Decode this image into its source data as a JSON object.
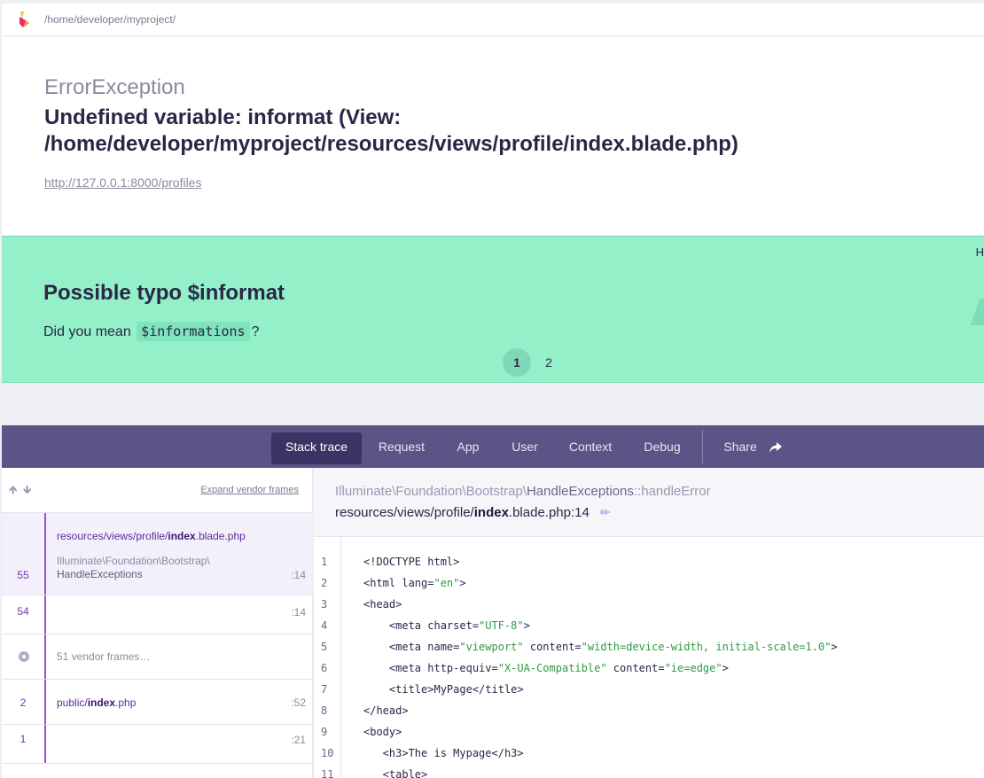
{
  "topbar": {
    "path": "/home/developer/myproject/"
  },
  "exception": {
    "class": "ErrorException",
    "message": "Undefined variable: informat (View: /home/developer/myproject/resources/views/profile/index.blade.php)",
    "url": "http://127.0.0.1:8000/profiles"
  },
  "solution": {
    "title": "Possible typo $informat",
    "text_before": "Did you mean",
    "code": "$informations",
    "text_after": "?",
    "tabs": [
      "1",
      "2"
    ],
    "edge_text": "H"
  },
  "tabs": [
    "Stack trace",
    "Request",
    "App",
    "User",
    "Context",
    "Debug"
  ],
  "share_label": "Share",
  "stack": {
    "expand_label": "Expand vendor frames",
    "frames": [
      {
        "num": "55",
        "file_prefix": "resources/views/profile/",
        "file_bold": "index",
        "file_suffix": ".blade.php",
        "cls1": "Illuminate\\Foundation\\Bootstrap\\",
        "cls2": "HandleExceptions",
        "line": ":14"
      },
      {
        "num": "54",
        "line": ":14"
      },
      {
        "vendor_label": "51 vendor frames…"
      },
      {
        "num": "2",
        "file_prefix": "public/",
        "file_bold": "index",
        "file_suffix": ".php",
        "line": ":52"
      },
      {
        "num": "1",
        "line": ":21"
      }
    ]
  },
  "code_view": {
    "namespace": "Illuminate\\Foundation\\Bootstrap\\",
    "class": "HandleExceptions",
    "method": "::handleError",
    "file_prefix": "resources/views/profile/",
    "file_bold": "index",
    "file_suffix": ".blade.php:14",
    "lines": [
      {
        "n": "1",
        "code": "<!DOCTYPE html>"
      },
      {
        "n": "2",
        "code": "<html lang=\"en\">"
      },
      {
        "n": "3",
        "code": "<head>"
      },
      {
        "n": "4",
        "code": "    <meta charset=\"UTF-8\">"
      },
      {
        "n": "5",
        "code": "    <meta name=\"viewport\" content=\"width=device-width, initial-scale=1.0\">"
      },
      {
        "n": "6",
        "code": "    <meta http-equiv=\"X-UA-Compatible\" content=\"ie=edge\">"
      },
      {
        "n": "7",
        "code": "    <title>MyPage</title>"
      },
      {
        "n": "8",
        "code": "</head>"
      },
      {
        "n": "9",
        "code": "<body>"
      },
      {
        "n": "10",
        "code": "   <h3>The is Mypage</h3>"
      },
      {
        "n": "11",
        "code": "   <table>"
      }
    ]
  }
}
